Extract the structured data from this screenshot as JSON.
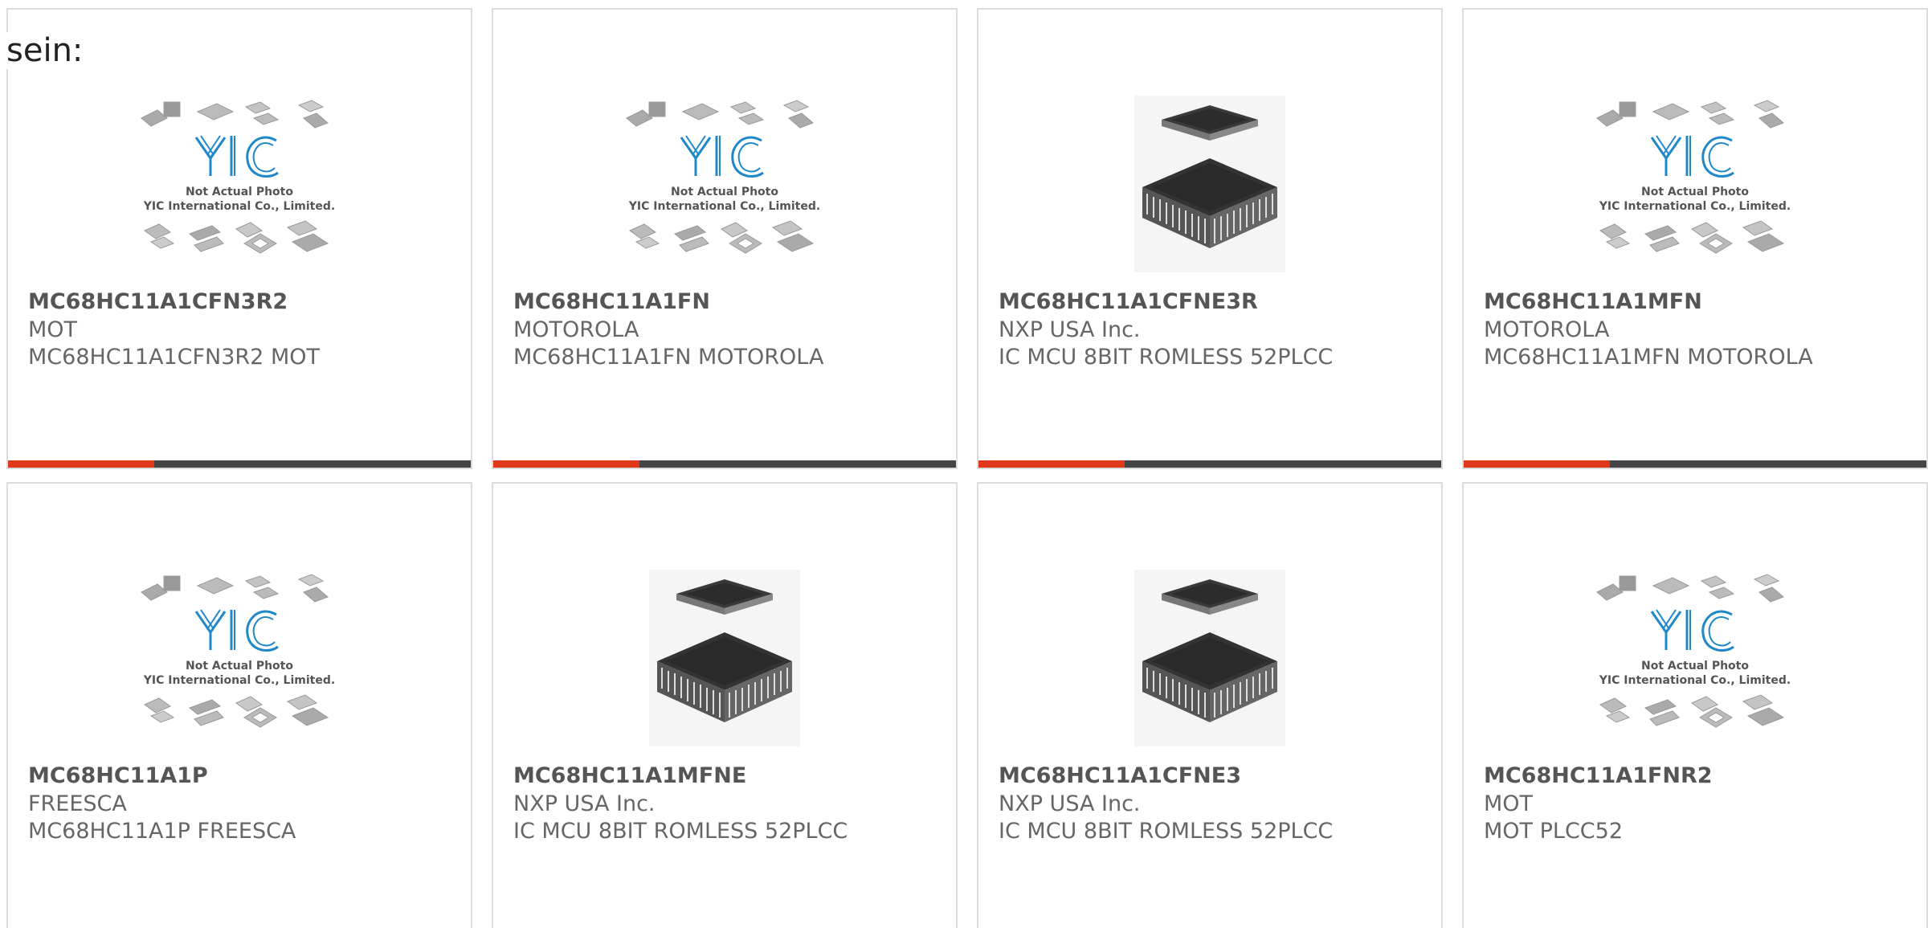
{
  "lead_text": "sein:",
  "placeholder": {
    "logo": "YIC",
    "line1": "Not Actual Photo",
    "line2": "YIC International Co., Limited."
  },
  "products": [
    {
      "part": "MC68HC11A1CFN3R2",
      "maker": "MOT",
      "desc": "MC68HC11A1CFN3R2 MOT",
      "image": "placeholder-icon"
    },
    {
      "part": "MC68HC11A1FN",
      "maker": "MOTOROLA",
      "desc": "MC68HC11A1FN MOTOROLA",
      "image": "placeholder-icon"
    },
    {
      "part": "MC68HC11A1CFNE3R",
      "maker": "NXP USA Inc.",
      "desc": "IC MCU 8BIT ROMLESS 52PLCC",
      "image": "plcc-chip-icon"
    },
    {
      "part": "MC68HC11A1MFN",
      "maker": "MOTOROLA",
      "desc": "MC68HC11A1MFN MOTOROLA",
      "image": "placeholder-icon"
    },
    {
      "part": "MC68HC11A1P",
      "maker": "FREESCA",
      "desc": "MC68HC11A1P FREESCA",
      "image": "placeholder-icon"
    },
    {
      "part": "MC68HC11A1MFNE",
      "maker": "NXP USA Inc.",
      "desc": "IC MCU 8BIT ROMLESS 52PLCC",
      "image": "plcc-chip-icon"
    },
    {
      "part": "MC68HC11A1CFNE3",
      "maker": "NXP USA Inc.",
      "desc": "IC MCU 8BIT ROMLESS 52PLCC",
      "image": "plcc-chip-icon"
    },
    {
      "part": "MC68HC11A1FNR2",
      "maker": "MOT",
      "desc": "MOT PLCC52",
      "image": "placeholder-icon"
    }
  ],
  "colors": {
    "accent": "#e0391b",
    "bar": "#444444",
    "logo_blue": "#1e88c8",
    "border": "#dcdcdc"
  }
}
